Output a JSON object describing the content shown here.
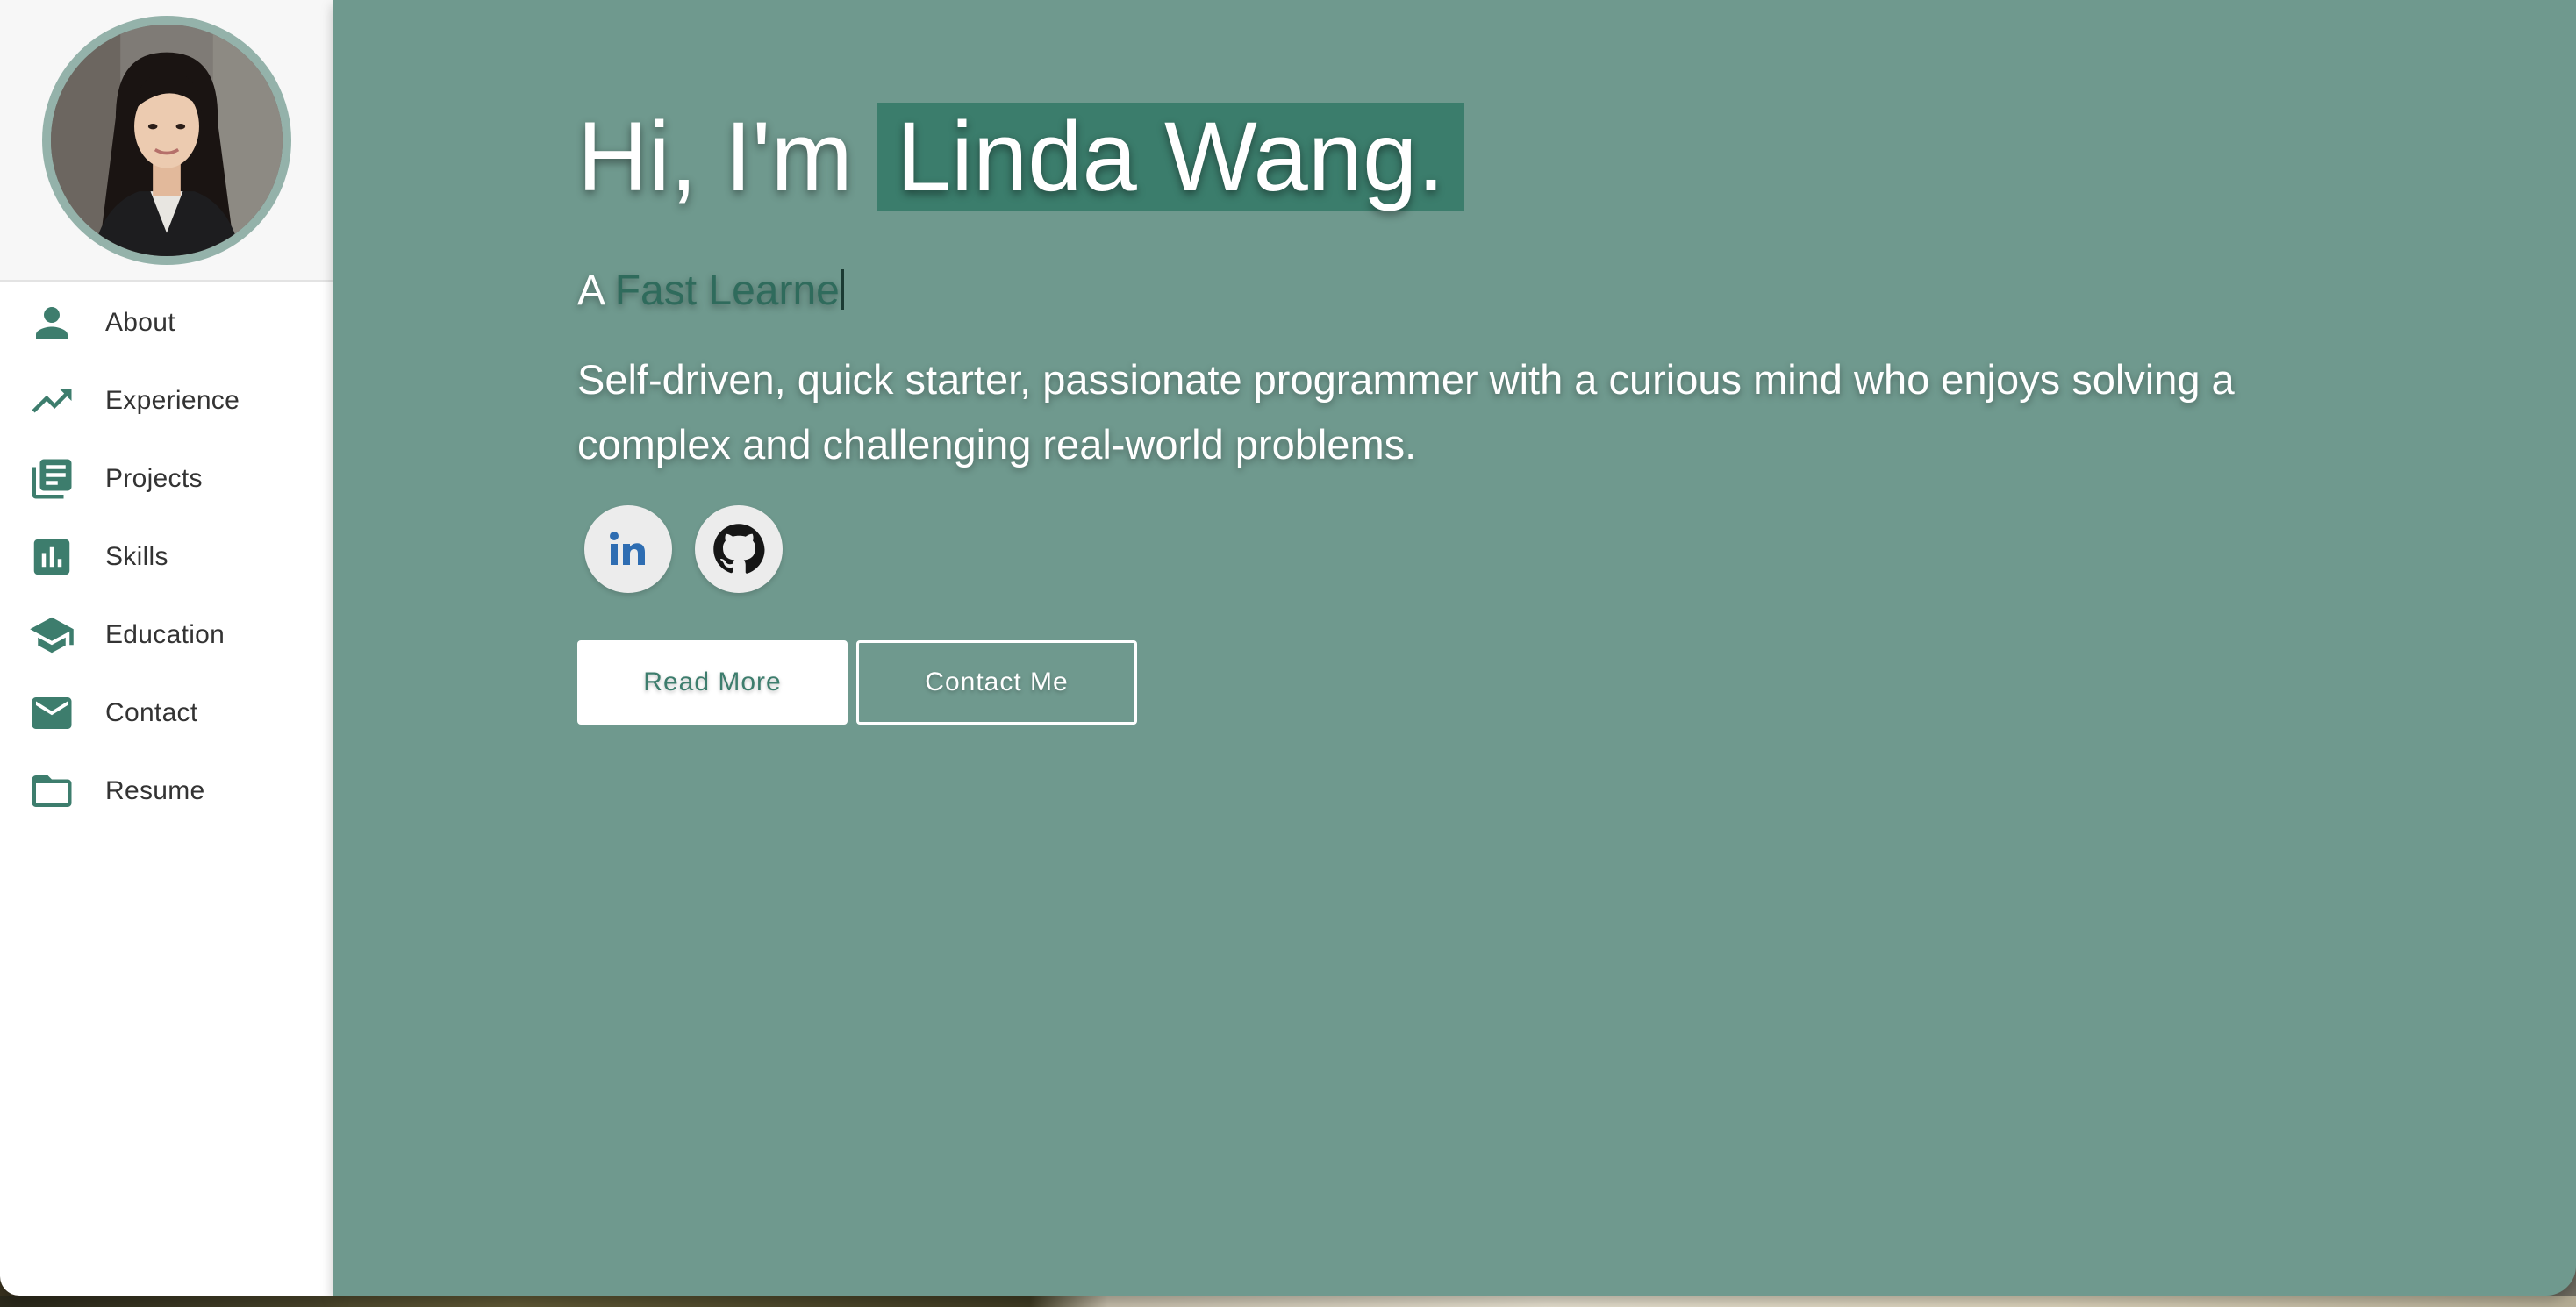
{
  "sidebar": {
    "avatar_alt": "Linda Wang",
    "items": [
      {
        "label": "About",
        "icon": "person-icon"
      },
      {
        "label": "Experience",
        "icon": "trending-up-icon"
      },
      {
        "label": "Projects",
        "icon": "library-books-icon"
      },
      {
        "label": "Skills",
        "icon": "bar-chart-icon"
      },
      {
        "label": "Education",
        "icon": "graduation-cap-icon"
      },
      {
        "label": "Contact",
        "icon": "mail-icon"
      },
      {
        "label": "Resume",
        "icon": "folder-icon"
      }
    ]
  },
  "hero": {
    "greeting_prefix": "Hi, I'm",
    "name": "Linda Wang.",
    "tagline_prefix": "A",
    "tagline_typed": "Fast Learne",
    "bio": "Self-driven, quick starter, passionate programmer with a curious mind who enjoys solving a complex and challenging real-world problems.",
    "socials": [
      {
        "name": "linkedin",
        "icon": "linkedin-icon"
      },
      {
        "name": "github",
        "icon": "github-icon"
      }
    ],
    "read_more_label": "Read More",
    "contact_label": "Contact Me"
  },
  "colors": {
    "accent": "#3d7d6d",
    "hero_bg": "#6f998e",
    "name_highlight": "#3b7d6c",
    "avatar_ring": "#94b2aa"
  }
}
